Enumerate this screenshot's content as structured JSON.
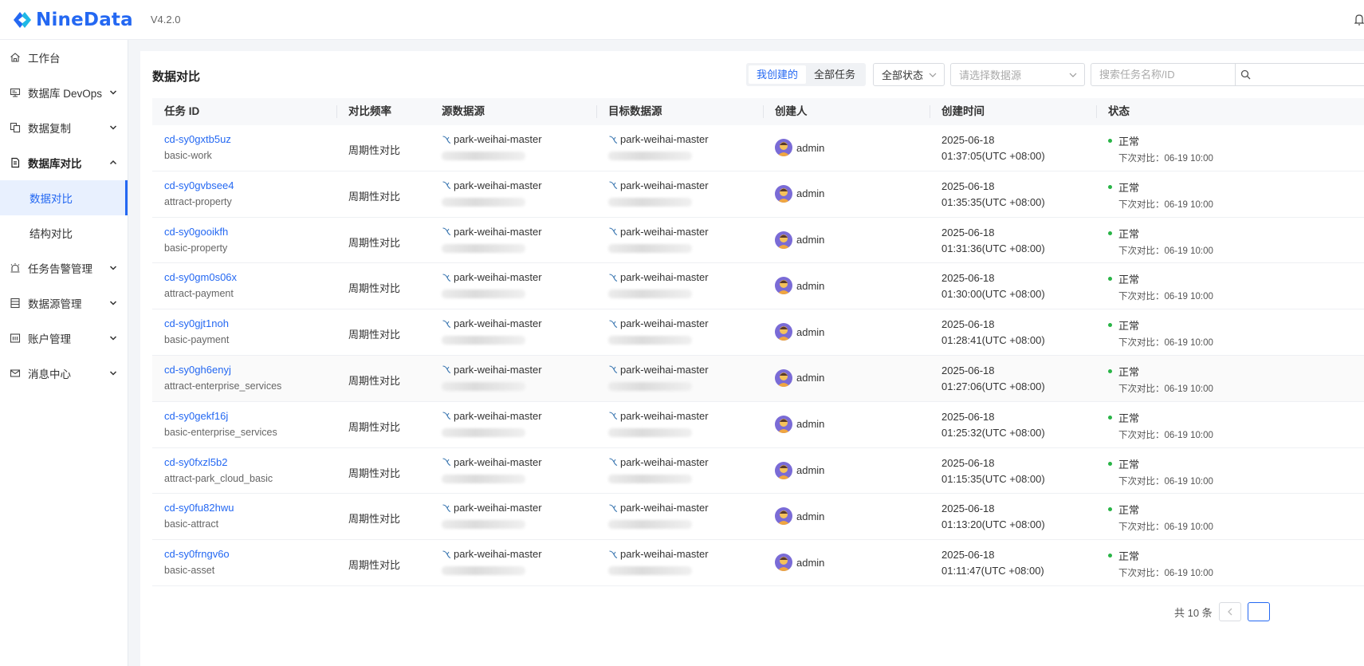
{
  "app": {
    "logo_text": "NineData",
    "version": "V4.2.0"
  },
  "sidebar": {
    "items": [
      {
        "label": "工作台",
        "icon": "home-icon"
      },
      {
        "label": "数据库 DevOps",
        "icon": "monitor-icon"
      },
      {
        "label": "数据复制",
        "icon": "copy-icon"
      },
      {
        "label": "数据库对比",
        "icon": "compare-doc-icon"
      },
      {
        "label": "任务告警管理",
        "icon": "alarm-icon"
      },
      {
        "label": "数据源管理",
        "icon": "datasource-icon"
      },
      {
        "label": "账户管理",
        "icon": "account-icon"
      },
      {
        "label": "消息中心",
        "icon": "mail-icon"
      }
    ],
    "sub_items": [
      {
        "label": "数据对比",
        "active": true
      },
      {
        "label": "结构对比",
        "active": false
      }
    ]
  },
  "page": {
    "title": "数据对比"
  },
  "filters": {
    "tab_mine": "我创建的",
    "tab_all": "全部任务",
    "status_select": "全部状态",
    "datasource_placeholder": "请选择数据源",
    "search_placeholder": "搜索任务名称/ID"
  },
  "table": {
    "headers": {
      "task_id": "任务 ID",
      "freq": "对比频率",
      "source": "源数据源",
      "target": "目标数据源",
      "creator": "创建人",
      "created": "创建时间",
      "status": "状态"
    },
    "rows": [
      {
        "id": "cd-sy0gxtb5uz",
        "name": "basic-work",
        "freq": "周期性对比",
        "source": "park-weihai-master",
        "target": "park-weihai-master",
        "creator": "admin",
        "date": "2025-06-18",
        "time": "01:37:05(UTC +08:00)",
        "status": "正常",
        "next": "下次对比：06-19 10:00"
      },
      {
        "id": "cd-sy0gvbsee4",
        "name": "attract-property",
        "freq": "周期性对比",
        "source": "park-weihai-master",
        "target": "park-weihai-master",
        "creator": "admin",
        "date": "2025-06-18",
        "time": "01:35:35(UTC +08:00)",
        "status": "正常",
        "next": "下次对比：06-19 10:00"
      },
      {
        "id": "cd-sy0gooikfh",
        "name": "basic-property",
        "freq": "周期性对比",
        "source": "park-weihai-master",
        "target": "park-weihai-master",
        "creator": "admin",
        "date": "2025-06-18",
        "time": "01:31:36(UTC +08:00)",
        "status": "正常",
        "next": "下次对比：06-19 10:00"
      },
      {
        "id": "cd-sy0gm0s06x",
        "name": "attract-payment",
        "freq": "周期性对比",
        "source": "park-weihai-master",
        "target": "park-weihai-master",
        "creator": "admin",
        "date": "2025-06-18",
        "time": "01:30:00(UTC +08:00)",
        "status": "正常",
        "next": "下次对比：06-19 10:00"
      },
      {
        "id": "cd-sy0gjt1noh",
        "name": "basic-payment",
        "freq": "周期性对比",
        "source": "park-weihai-master",
        "target": "park-weihai-master",
        "creator": "admin",
        "date": "2025-06-18",
        "time": "01:28:41(UTC +08:00)",
        "status": "正常",
        "next": "下次对比：06-19 10:00"
      },
      {
        "id": "cd-sy0gh6enyj",
        "name": "attract-enterprise_services",
        "freq": "周期性对比",
        "source": "park-weihai-master",
        "target": "park-weihai-master",
        "creator": "admin",
        "date": "2025-06-18",
        "time": "01:27:06(UTC +08:00)",
        "status": "正常",
        "next": "下次对比：06-19 10:00"
      },
      {
        "id": "cd-sy0gekf16j",
        "name": "basic-enterprise_services",
        "freq": "周期性对比",
        "source": "park-weihai-master",
        "target": "park-weihai-master",
        "creator": "admin",
        "date": "2025-06-18",
        "time": "01:25:32(UTC +08:00)",
        "status": "正常",
        "next": "下次对比：06-19 10:00"
      },
      {
        "id": "cd-sy0fxzl5b2",
        "name": "attract-park_cloud_basic",
        "freq": "周期性对比",
        "source": "park-weihai-master",
        "target": "park-weihai-master",
        "creator": "admin",
        "date": "2025-06-18",
        "time": "01:15:35(UTC +08:00)",
        "status": "正常",
        "next": "下次对比：06-19 10:00"
      },
      {
        "id": "cd-sy0fu82hwu",
        "name": "basic-attract",
        "freq": "周期性对比",
        "source": "park-weihai-master",
        "target": "park-weihai-master",
        "creator": "admin",
        "date": "2025-06-18",
        "time": "01:13:20(UTC +08:00)",
        "status": "正常",
        "next": "下次对比：06-19 10:00"
      },
      {
        "id": "cd-sy0frngv6o",
        "name": "basic-asset",
        "freq": "周期性对比",
        "source": "park-weihai-master",
        "target": "park-weihai-master",
        "creator": "admin",
        "date": "2025-06-18",
        "time": "01:11:47(UTC +08:00)",
        "status": "正常",
        "next": "下次对比：06-19 10:00"
      }
    ]
  },
  "pagination": {
    "total": "共 10 条"
  },
  "colors": {
    "accent": "#2468f2",
    "status_ok": "#28b446"
  }
}
